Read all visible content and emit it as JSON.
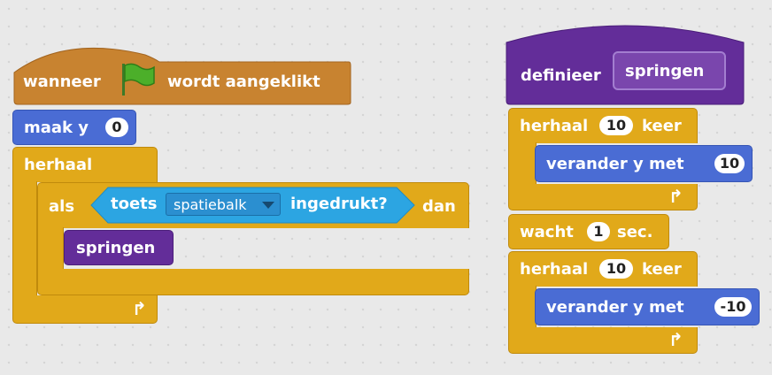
{
  "script_left": {
    "hat_when": "wanneer",
    "hat_clicked": "wordt aangeklikt",
    "set_y_label": "maak y",
    "set_y_value": "0",
    "forever_label": "herhaal",
    "if_label": "als",
    "key_label": "toets",
    "key_value": "spatiebalk",
    "pressed_label": "ingedrukt?",
    "then_label": "dan",
    "call_label": "springen"
  },
  "script_right": {
    "define_label": "definieer",
    "define_name": "springen",
    "repeat1_label": "herhaal",
    "repeat1_value": "10",
    "repeat1_unit": "keer",
    "change1_label": "verander y met",
    "change1_value": "10",
    "wait_label": "wacht",
    "wait_value": "1",
    "wait_unit": "sec.",
    "repeat2_label": "herhaal",
    "repeat2_value": "10",
    "repeat2_unit": "keer",
    "change2_label": "verander y met",
    "change2_value": "-10"
  },
  "icons": {
    "flag": "green-flag-icon",
    "loop_arrow": "loop-arrow-icon",
    "dropdown": "dropdown-arrow-icon"
  },
  "colors": {
    "events": "#c88330",
    "control": "#e1a91a",
    "motion": "#4a6cd4",
    "custom": "#632d99",
    "sensing": "#2ca5e2"
  }
}
